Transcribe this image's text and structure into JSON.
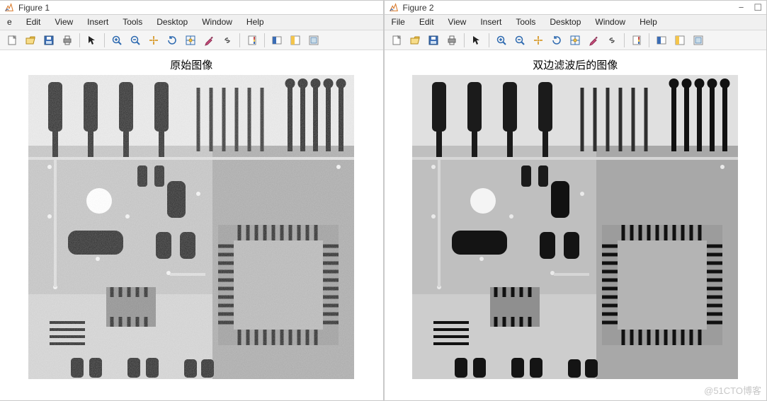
{
  "windows": [
    {
      "title": "Figure 1",
      "menus": [
        "e",
        "Edit",
        "View",
        "Insert",
        "Tools",
        "Desktop",
        "Window",
        "Help"
      ],
      "plot_title": "原始图像",
      "win_controls": false
    },
    {
      "title": "Figure 2",
      "menus": [
        "File",
        "Edit",
        "View",
        "Insert",
        "Tools",
        "Desktop",
        "Window",
        "Help"
      ],
      "plot_title": "双边滤波后的图像",
      "win_controls": true
    }
  ],
  "toolbar_buttons": [
    "new-figure",
    "open-file",
    "save-figure",
    "print-figure",
    "SEP",
    "edit-plot",
    "SEP",
    "zoom-in",
    "zoom-out",
    "pan",
    "rotate-3d",
    "data-cursor",
    "brush",
    "link",
    "SEP",
    "insert-colorbar",
    "SEP",
    "insert-legend",
    "hide-plot-tools",
    "show-plot-tools"
  ],
  "watermark": "@51CTO博客"
}
